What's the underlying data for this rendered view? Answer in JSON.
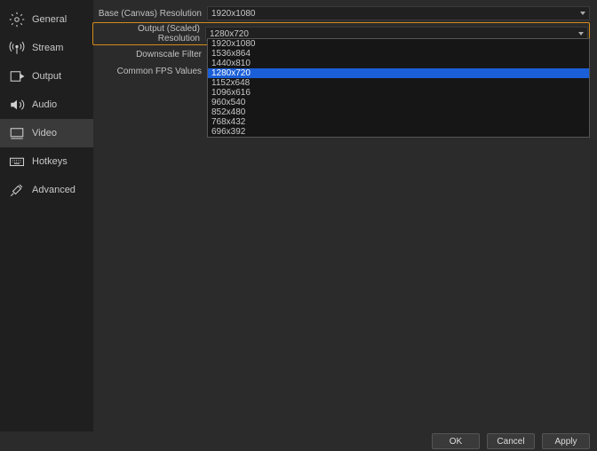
{
  "sidebar": {
    "items": [
      {
        "label": "General"
      },
      {
        "label": "Stream"
      },
      {
        "label": "Output"
      },
      {
        "label": "Audio"
      },
      {
        "label": "Video"
      },
      {
        "label": "Hotkeys"
      },
      {
        "label": "Advanced"
      }
    ]
  },
  "labels": {
    "base": "Base (Canvas) Resolution",
    "output": "Output (Scaled) Resolution",
    "filter": "Downscale Filter",
    "fps": "Common FPS Values"
  },
  "values": {
    "base": "1920x1080",
    "output": "1280x720"
  },
  "dropdown": {
    "options": [
      "1920x1080",
      "1536x864",
      "1440x810",
      "1280x720",
      "1152x648",
      "1096x616",
      "960x540",
      "852x480",
      "768x432",
      "696x392"
    ],
    "selected": "1280x720"
  },
  "buttons": {
    "ok": "OK",
    "cancel": "Cancel",
    "apply": "Apply"
  }
}
